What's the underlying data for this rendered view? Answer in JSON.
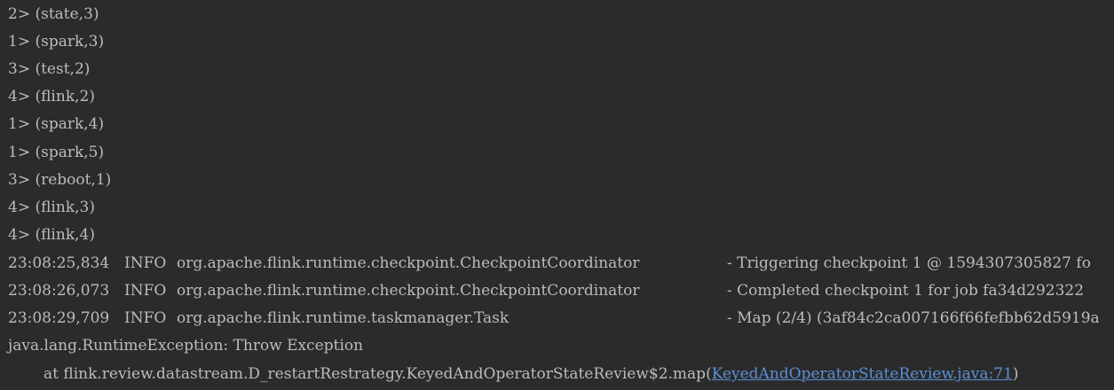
{
  "console": {
    "background": "#2b2b2b",
    "text_color": "#b9bcbf",
    "link_color": "#5a8fd6",
    "output_lines": [
      "2> (state,3)",
      "1> (spark,3)",
      "3> (test,2)",
      "4> (flink,2)",
      "1> (spark,4)",
      "1> (spark,5)",
      "3> (reboot,1)",
      "4> (flink,3)",
      "4> (flink,4)"
    ],
    "log_lines": [
      {
        "time": "23:08:25,834",
        "level": "INFO",
        "logger": "org.apache.flink.runtime.checkpoint.CheckpointCoordinator",
        "message": "- Triggering checkpoint 1 @ 1594307305827 fo"
      },
      {
        "time": "23:08:26,073",
        "level": "INFO",
        "logger": "org.apache.flink.runtime.checkpoint.CheckpointCoordinator",
        "message": "- Completed checkpoint 1 for job fa34d292322"
      },
      {
        "time": "23:08:29,709",
        "level": "INFO",
        "logger": "org.apache.flink.runtime.taskmanager.Task",
        "message": "- Map (2/4) (3af84c2ca007166f66fefbb62d5919a"
      }
    ],
    "exception": {
      "header": "java.lang.RuntimeException: Throw Exception",
      "frame_prefix": "at flink.review.datastream.D_restartRestrategy.KeyedAndOperatorStateReview$2.map(",
      "frame_link": "KeyedAndOperatorStateReview.java:71",
      "frame_suffix": ")"
    }
  }
}
